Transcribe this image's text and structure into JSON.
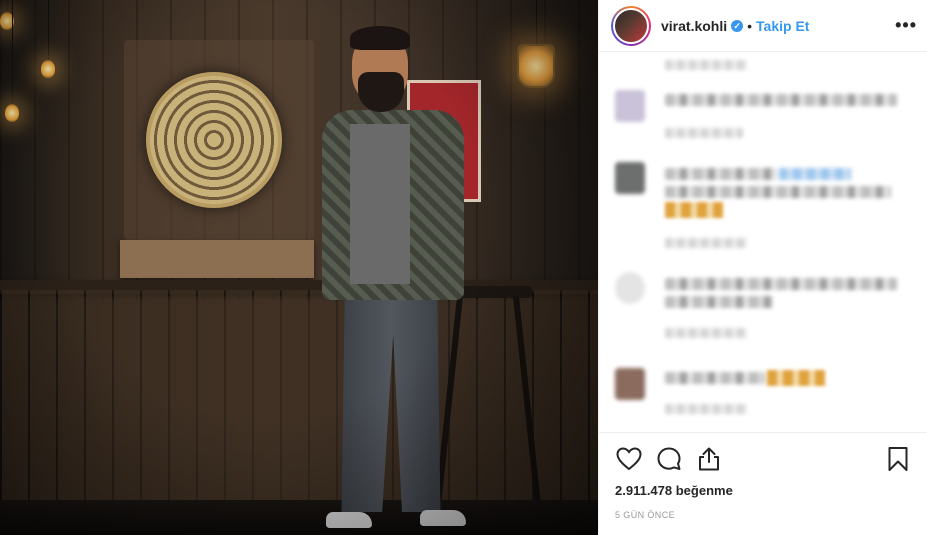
{
  "post": {
    "photo_icon": "photo",
    "photo_description": "Man in checkered shirt standing in bar with dartboard"
  },
  "header": {
    "username": "virat.kohli",
    "verified_icon": "verified-badge-icon",
    "separator": "•",
    "follow_label": "Takip Et",
    "more_icon": "ellipsis-icon",
    "more_label": "•••"
  },
  "comments": {
    "blurred": true,
    "count_visible": 5
  },
  "actions": {
    "like_icon": "heart-icon",
    "comment_icon": "comment-icon",
    "share_icon": "share-icon",
    "save_icon": "bookmark-icon",
    "likes_text": "2.911.478 beğenme",
    "time_text": "5 GÜN ÖNCE"
  },
  "colors": {
    "accent": "#3897f0",
    "text": "#262626",
    "muted": "#999999",
    "divider": "#efefef"
  }
}
